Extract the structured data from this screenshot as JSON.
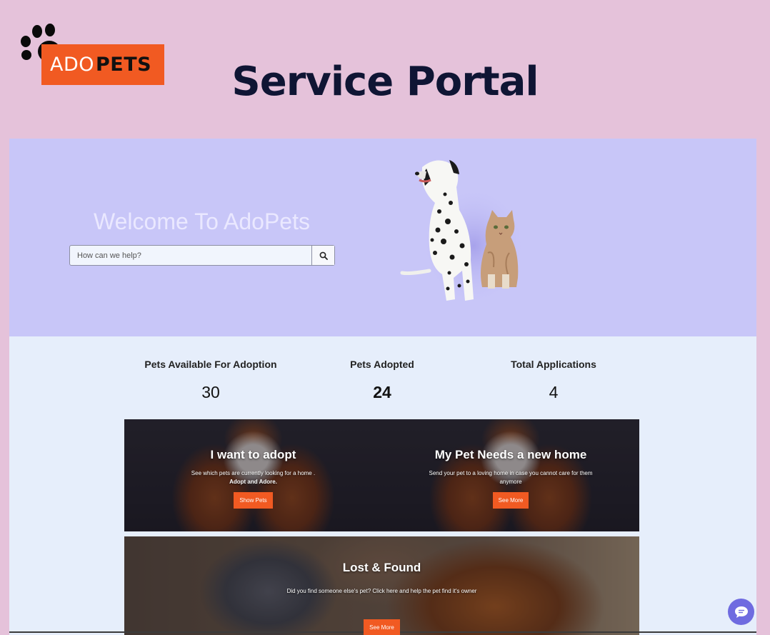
{
  "brand": {
    "logo_text_a": "ADO",
    "logo_text_b": "PETS"
  },
  "header": {
    "title": "Service Portal"
  },
  "hero": {
    "welcome": "Welcome To AdoPets",
    "search": {
      "placeholder": "How can we help?",
      "value": ""
    }
  },
  "stats": [
    {
      "label": "Pets Available For Adoption",
      "value": "30"
    },
    {
      "label": "Pets Adopted",
      "value": "24"
    },
    {
      "label": "Total Applications",
      "value": "4"
    }
  ],
  "cards": [
    {
      "title": "I want to adopt",
      "desc": "See which pets are currently looking for a home .",
      "desc_bold": "Adopt and Adore.",
      "button": "Show Pets"
    },
    {
      "title": "My Pet Needs a new home",
      "desc": "Send your pet to a loving home in case you cannot care for them anymore",
      "button": "See More"
    },
    {
      "title": "Lost & Found",
      "desc": "Did you find someone else's pet? Click here and help the pet find it's owner",
      "button": "See More"
    }
  ],
  "colors": {
    "page_bg": "#e5c2da",
    "hero_bg": "#c8c6f8",
    "panel_bg": "#e6eefb",
    "accent": "#f15a22",
    "title": "#0f1534",
    "chat": "#6f6be0"
  },
  "icons": [
    "paw-icon",
    "search-icon",
    "chat-icon"
  ]
}
